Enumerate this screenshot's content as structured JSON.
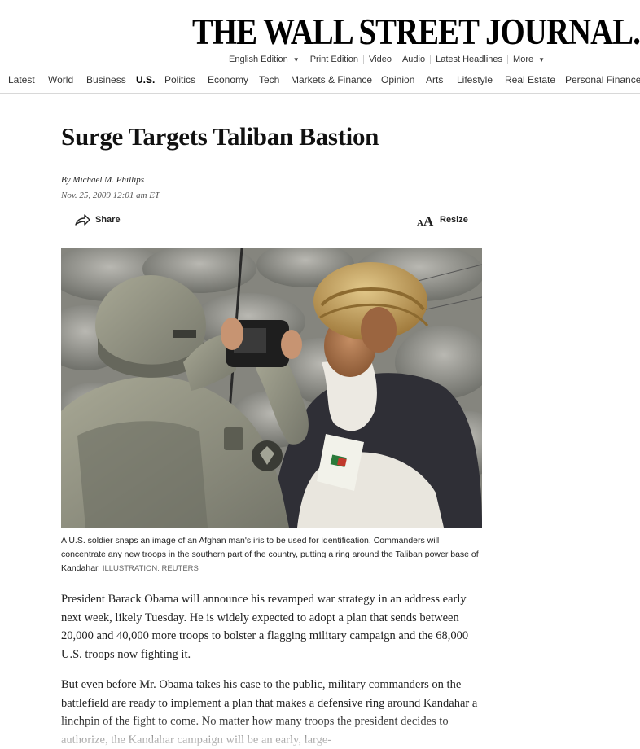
{
  "masthead": {
    "logo": "THE WALL STREET JOURNAL.",
    "edition_links": [
      "English Edition",
      "Print Edition",
      "Video",
      "Audio",
      "Latest Headlines",
      "More"
    ]
  },
  "nav": {
    "items": [
      "Latest",
      "World",
      "Business",
      "U.S.",
      "Politics",
      "Economy",
      "Tech",
      "Markets & Finance",
      "Opinion",
      "Arts",
      "Lifestyle",
      "Real Estate",
      "Personal Finance"
    ],
    "active": "U.S."
  },
  "article": {
    "headline": "Surge Targets Taliban Bastion",
    "byline": "By Michael M. Phillips",
    "date": "Nov. 25, 2009 12:01 am ET",
    "share_label": "Share",
    "resize_label": "Resize",
    "caption": "A U.S. soldier snaps an image of an Afghan man's iris to be used for identification. Commanders will concentrate any new troops in the southern part of the country, putting a ring around the Taliban power base of Kandahar.",
    "credit": "ILLUSTRATION: REUTERS",
    "paragraphs": [
      "President Barack Obama will announce his revamped war strategy in an address early next week, likely Tuesday. He is widely expected to adopt a plan that sends between 20,000 and 40,000 more troops to bolster a flagging military campaign and the 68,000 U.S. troops now fighting it.",
      "But even before Mr. Obama takes his case to the public, military commanders on the battlefield are ready to implement a plan that makes a defensive ring around Kandahar a linchpin of the fight to come. No matter how many troops the president decides to authorize, the Kandahar campaign will be an early, large-"
    ]
  },
  "icons": {
    "share": "share-arrow-icon",
    "resize": "text-resize-icon",
    "dropdown": "caret-down-icon"
  },
  "colors": {
    "text": "#111111",
    "rule": "#d8d8d8",
    "muted": "#666666"
  }
}
